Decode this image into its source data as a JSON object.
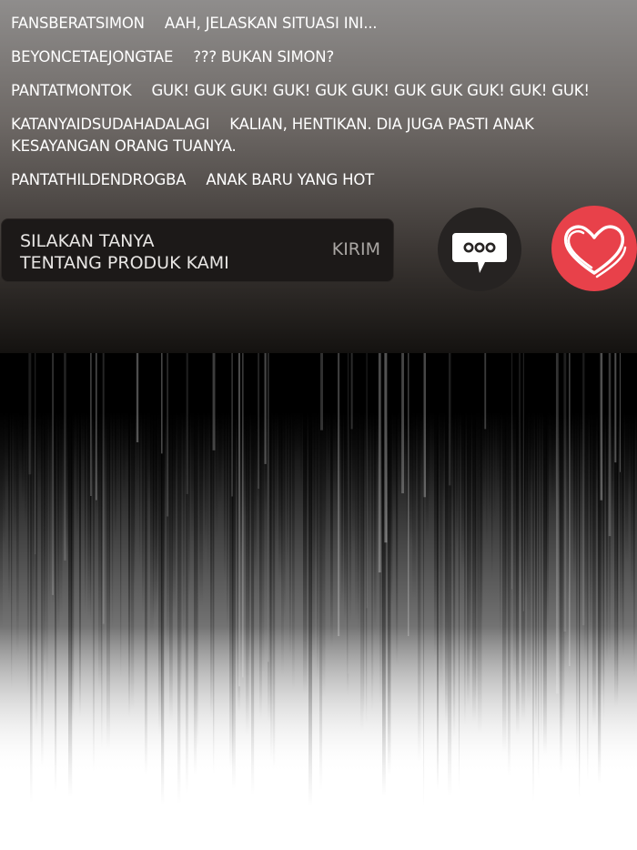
{
  "comments": [
    {
      "user": "FANSBERATSIMON",
      "text": "AAH, JELASKAN SITUASI INI..."
    },
    {
      "user": "BEYONCETAEJONGTAE",
      "text": "??? BUKAN SIMON?"
    },
    {
      "user": "PANTATMONTOK",
      "text": "GUK! GUK GUK! GUK! GUK GUK! GUK GUK GUK! GUK! GUK!"
    },
    {
      "user": "KATANYAIDSUDAHADALAGI",
      "text": "KALIAN, HENTIKAN. DIA JUGA PASTI ANAK KESAYANGAN ORANG TUANYA."
    },
    {
      "user": "PANTATHILDENDROGBA",
      "text": "ANAK BARU YANG HOT"
    }
  ],
  "input": {
    "placeholder_line1": "SILAKAN TANYA",
    "placeholder_line2": "TENTANG PRODUK KAMI",
    "send_label": "KIRIM"
  },
  "icons": {
    "chat": "speech-bubble-icon",
    "like": "heart-icon"
  },
  "colors": {
    "like_button": "#e8414a",
    "chat_button": "#262322"
  }
}
